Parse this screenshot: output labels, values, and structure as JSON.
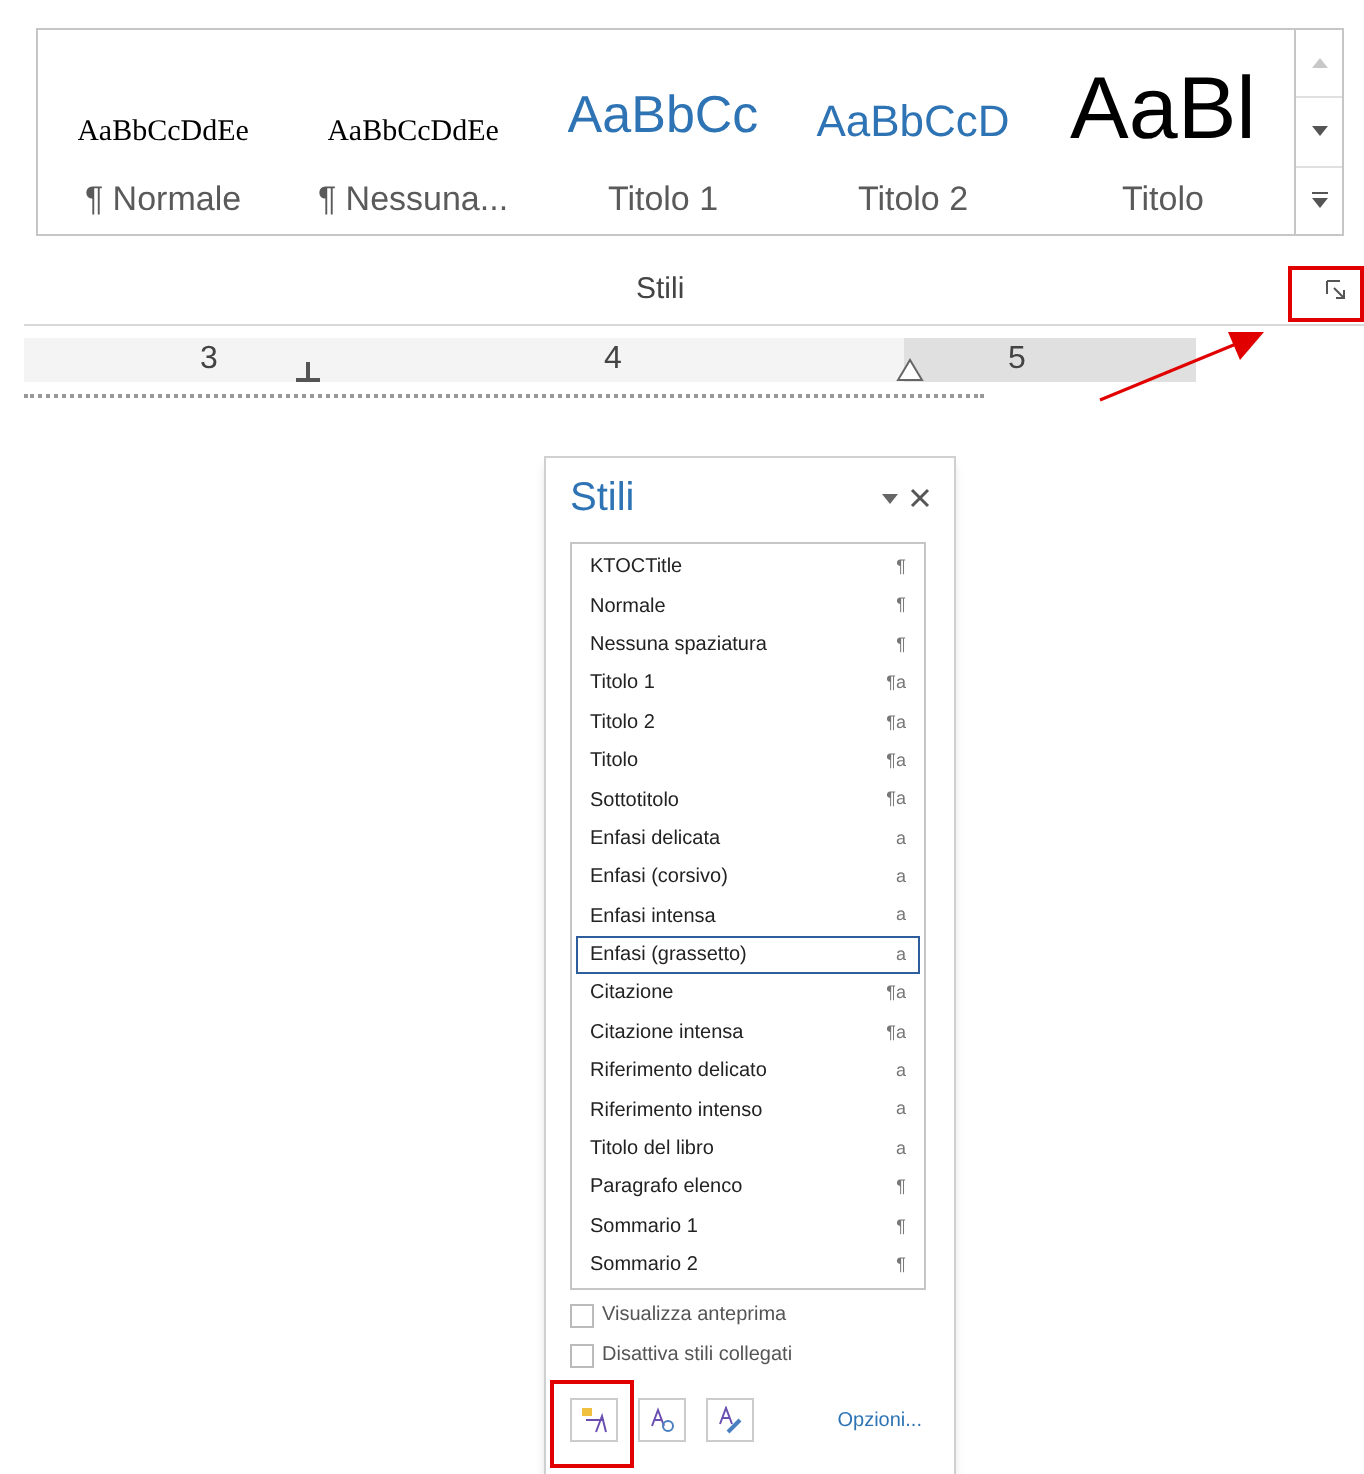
{
  "gallery": {
    "items": [
      {
        "preview": "AaBbCcDdEe",
        "label": "¶ Normale",
        "kind": "serif"
      },
      {
        "preview": "AaBbCcDdEe",
        "label": "¶ Nessuna...",
        "kind": "serif"
      },
      {
        "preview": "AaBbCc",
        "label": "Titolo 1",
        "kind": "heading1"
      },
      {
        "preview": "AaBbCcD",
        "label": "Titolo 2",
        "kind": "heading2"
      },
      {
        "preview": "AaBl",
        "label": "Titolo",
        "kind": "title"
      }
    ]
  },
  "group_label": "Stili",
  "ruler": {
    "numbers": [
      "3",
      "4",
      "5"
    ]
  },
  "panel": {
    "title": "Stili",
    "styles": [
      {
        "name": "KTOCTitle",
        "mark": "¶",
        "selected": false
      },
      {
        "name": "Normale",
        "mark": "¶",
        "selected": false
      },
      {
        "name": "Nessuna spaziatura",
        "mark": "¶",
        "selected": false
      },
      {
        "name": "Titolo 1",
        "mark": "¶a",
        "selected": false
      },
      {
        "name": "Titolo 2",
        "mark": "¶a",
        "selected": false
      },
      {
        "name": "Titolo",
        "mark": "¶a",
        "selected": false
      },
      {
        "name": "Sottotitolo",
        "mark": "¶a",
        "selected": false
      },
      {
        "name": "Enfasi delicata",
        "mark": "a",
        "selected": false
      },
      {
        "name": "Enfasi (corsivo)",
        "mark": "a",
        "selected": false
      },
      {
        "name": "Enfasi intensa",
        "mark": "a",
        "selected": false
      },
      {
        "name": "Enfasi (grassetto)",
        "mark": "a",
        "selected": true
      },
      {
        "name": "Citazione",
        "mark": "¶a",
        "selected": false
      },
      {
        "name": "Citazione intensa",
        "mark": "¶a",
        "selected": false
      },
      {
        "name": "Riferimento delicato",
        "mark": "a",
        "selected": false
      },
      {
        "name": "Riferimento intenso",
        "mark": "a",
        "selected": false
      },
      {
        "name": "Titolo del libro",
        "mark": "a",
        "selected": false
      },
      {
        "name": "Paragrafo elenco",
        "mark": "¶",
        "selected": false
      },
      {
        "name": "Sommario 1",
        "mark": "¶",
        "selected": false
      },
      {
        "name": "Sommario 2",
        "mark": "¶",
        "selected": false
      }
    ],
    "options": [
      {
        "label": "Visualizza anteprima",
        "checked": false
      },
      {
        "label": "Disattiva stili collegati",
        "checked": false
      }
    ],
    "link": "Opzioni..."
  }
}
